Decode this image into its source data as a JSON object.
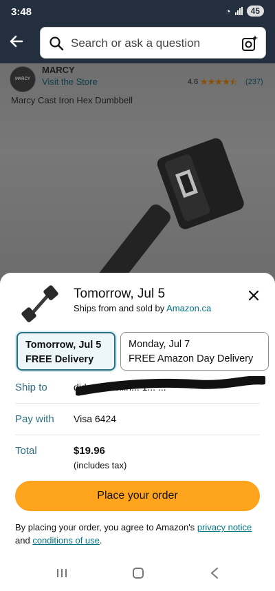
{
  "status_bar": {
    "time": "3:48",
    "battery": "45"
  },
  "search": {
    "placeholder": "Search or ask a question"
  },
  "product": {
    "brand": "MARCY",
    "logo_text": "MARCY",
    "visit_store": "Visit the Store",
    "rating": "4.6",
    "stars": 4.5,
    "rating_count": "(237)",
    "title": "Marcy Cast Iron Hex Dumbbell"
  },
  "sheet": {
    "delivery_date": "Tomorrow, Jul 5",
    "ships_prefix": "Ships from and sold by ",
    "ships_seller": "Amazon.ca",
    "options": [
      {
        "line1": "Tomorrow, Jul 5",
        "line2": "FREE Delivery",
        "selected": true
      },
      {
        "line1": "Monday, Jul 7",
        "line2": "FREE Amazon Day Delivery",
        "selected": false
      }
    ],
    "ship_to_label": "Ship to",
    "ship_to_value": "did... ... Pollin... 1... ...",
    "pay_with_label": "Pay with",
    "pay_with_value": "Visa 6424",
    "total_label": "Total",
    "total_value": "$19.96",
    "tax_note": "(includes tax)",
    "place_order": "Place your order",
    "legal_prefix": "By placing your order, you agree to Amazon's ",
    "privacy_link": "privacy notice",
    "legal_middle": " and ",
    "conditions_link": "conditions of use",
    "legal_suffix": "."
  },
  "colors": {
    "header": "#232f3e",
    "accent": "#ffa41c",
    "link": "#007185",
    "selected_border": "#2d6e82"
  },
  "icons": [
    "back-arrow-icon",
    "search-icon",
    "camera-search-icon",
    "close-icon",
    "wifi-icon",
    "signal-icon",
    "nav-recent-icon",
    "nav-home-icon",
    "nav-back-icon"
  ]
}
